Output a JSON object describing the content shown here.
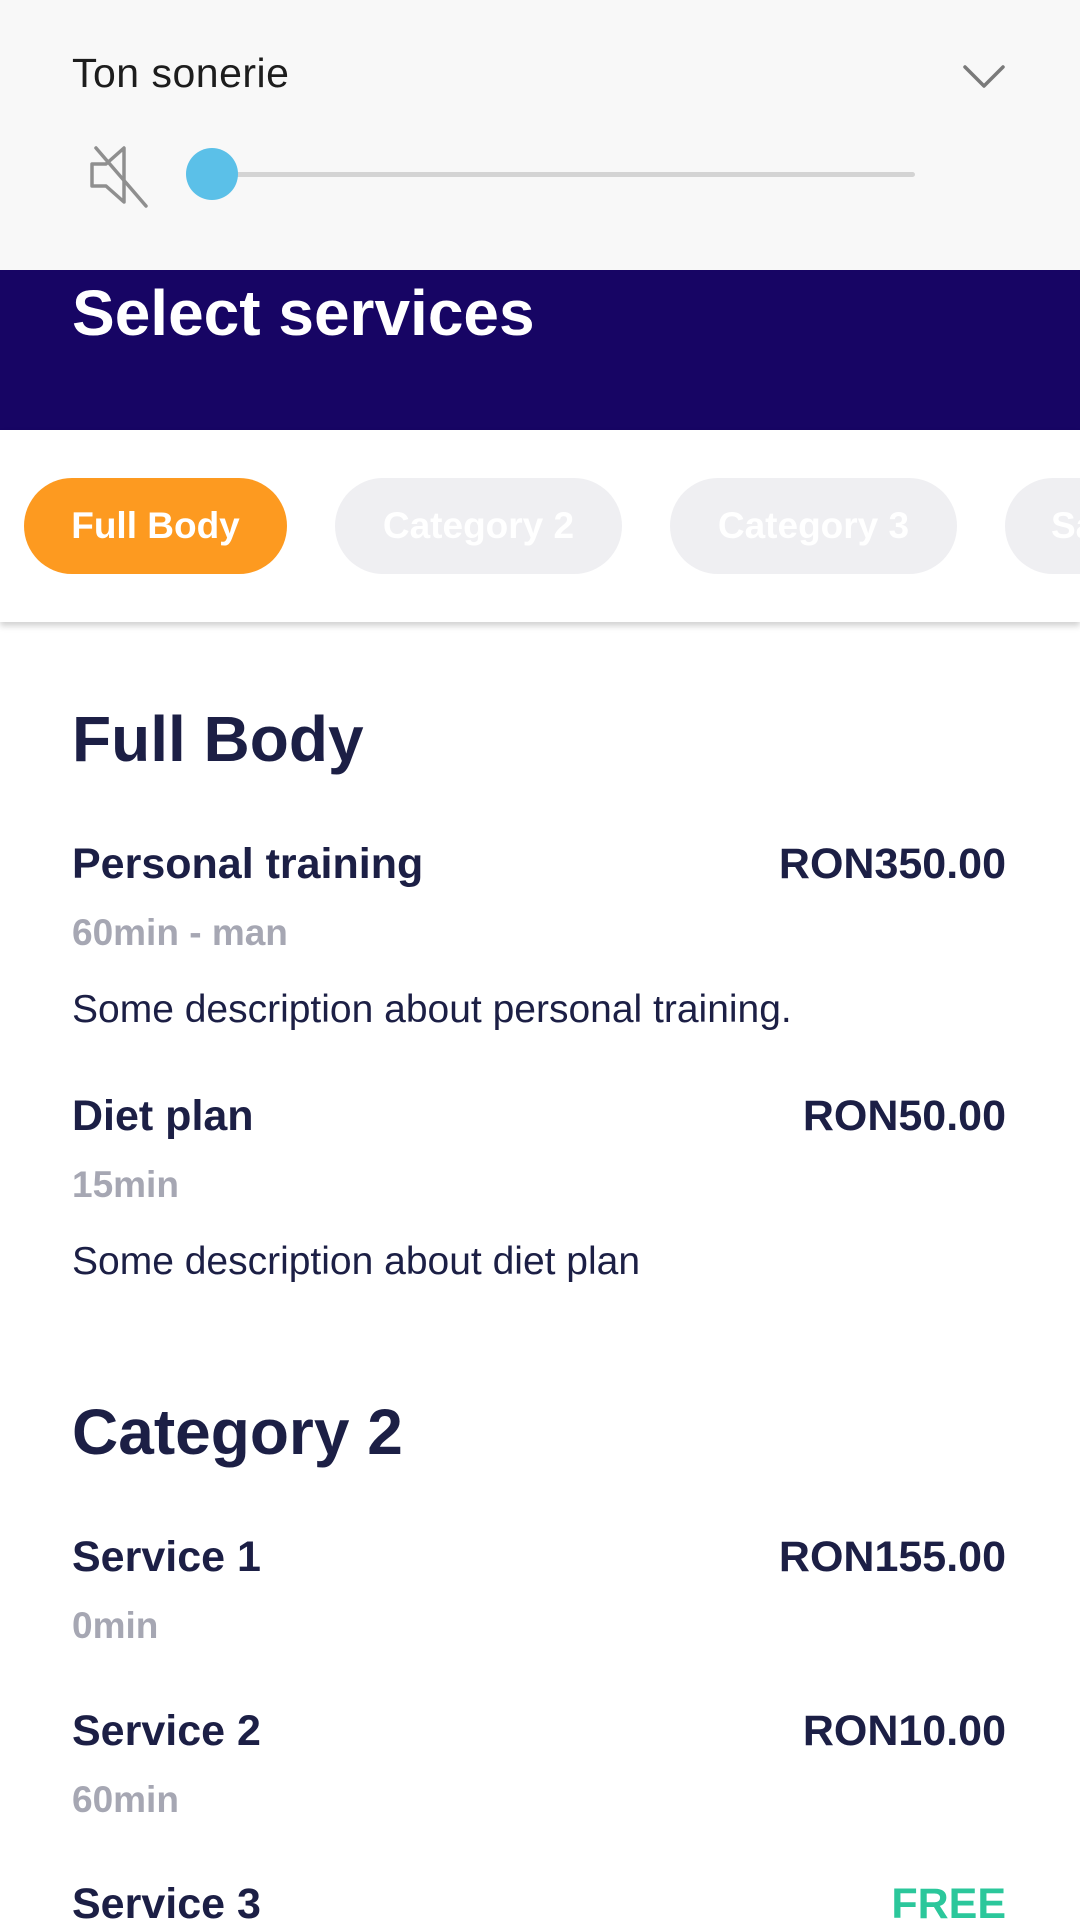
{
  "volume_panel": {
    "title": "Ton sonerie",
    "level": 0,
    "muted": true,
    "accent_color": "#5bc0e8"
  },
  "header": {
    "title": "Select services",
    "background": "#170564"
  },
  "categories": [
    {
      "label": "Full Body",
      "active": true
    },
    {
      "label": "Category 2",
      "active": false
    },
    {
      "label": "Category 3",
      "active": false
    },
    {
      "label": "Sa",
      "active": false
    }
  ],
  "sections": [
    {
      "title": "Full Body",
      "services": [
        {
          "name": "Personal training",
          "price": "RON350.00",
          "meta": "60min - man",
          "description": "Some description about personal training."
        },
        {
          "name": "Diet plan",
          "price": "RON50.00",
          "meta": "15min",
          "description": "Some description about diet plan"
        }
      ]
    },
    {
      "title": "Category 2",
      "services": [
        {
          "name": "Service 1",
          "price": "RON155.00",
          "meta": "0min"
        },
        {
          "name": "Service 2",
          "price": "RON10.00",
          "meta": "60min"
        },
        {
          "name": "Service 3",
          "price": "FREE",
          "price_color": "#2bc79b"
        }
      ]
    }
  ],
  "colors": {
    "active_pill": "#fd9a20",
    "inactive_pill": "#efeff2",
    "text_primary": "#1c1f45",
    "text_muted": "#a6a7b3"
  }
}
